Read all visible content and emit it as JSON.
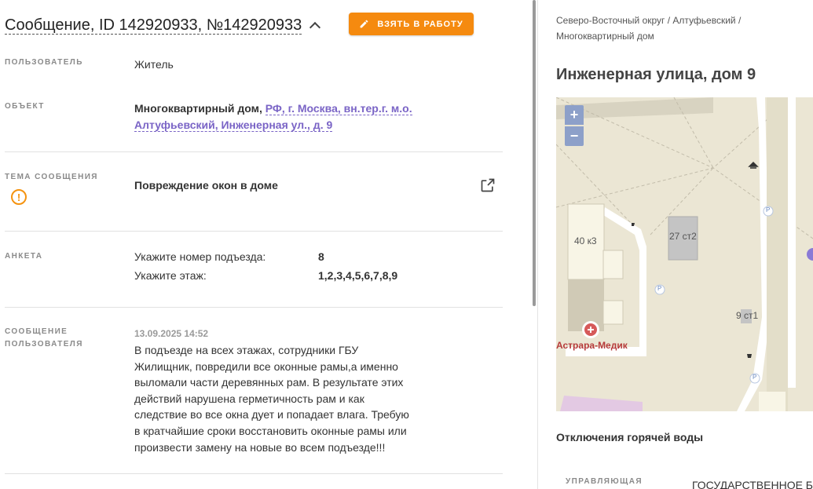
{
  "header": {
    "title": "Сообщение, ID 142920933, №142920933",
    "take_button": "ВЗЯТЬ В РАБОТУ"
  },
  "fields": {
    "user_label": "ПОЛЬЗОВАТЕЛЬ",
    "user_value": "Житель",
    "object_label": "ОБЪЕКТ",
    "object_type": "Многоквартирный дом,",
    "object_address": "РФ, г. Москва, вн.тер.г. м.о. Алтуфьевский, Инженерная ул., д. 9",
    "topic_label": "ТЕМА СООБЩЕНИЯ",
    "topic_value": "Повреждение окон в доме",
    "survey_label": "АНКЕТА",
    "survey": [
      {
        "question": "Укажите номер подъезда:",
        "answer": "8"
      },
      {
        "question": "Укажите этаж:",
        "answer": "1,2,3,4,5,6,7,8,9"
      }
    ],
    "message_label_line1": "СООБЩЕНИЕ",
    "message_label_line2": "ПОЛЬЗОВАТЕЛЯ",
    "message_date": "13.09.2025 14:52",
    "message_text": "В подъезде на всех этажах, сотрудники ГБУ Жилищник, повредили все оконные рамы,а именно выломали части деревянных рам. В результате этих действий нарушена герметичность рам и как следствие во все окна дует и попадает влага. Требую в кратчайшие сроки восстановить оконные рамы или произвести замену на новые во всем подъезде!!!"
  },
  "sidebar": {
    "breadcrumb": "Северо-Восточный округ / Алтуфьевский / Многоквартирный дом",
    "address": "Инженерная улица, дом 9",
    "map": {
      "zoom_in": "+",
      "zoom_out": "−",
      "labels": {
        "b1": "40 к3",
        "b2": "27 ст2",
        "b3": "9 ст1",
        "poi": "Астрара-Медик",
        "p": "P"
      }
    },
    "hot_water": "Отключения горячей воды",
    "manager_label": "УПРАВЛЯЮЩАЯ",
    "manager_value": "ГОСУДАРСТВЕННОЕ БЮ"
  },
  "colors": {
    "accent": "#f58a0f",
    "link": "#7a64c6",
    "warning": "#f5930f"
  }
}
